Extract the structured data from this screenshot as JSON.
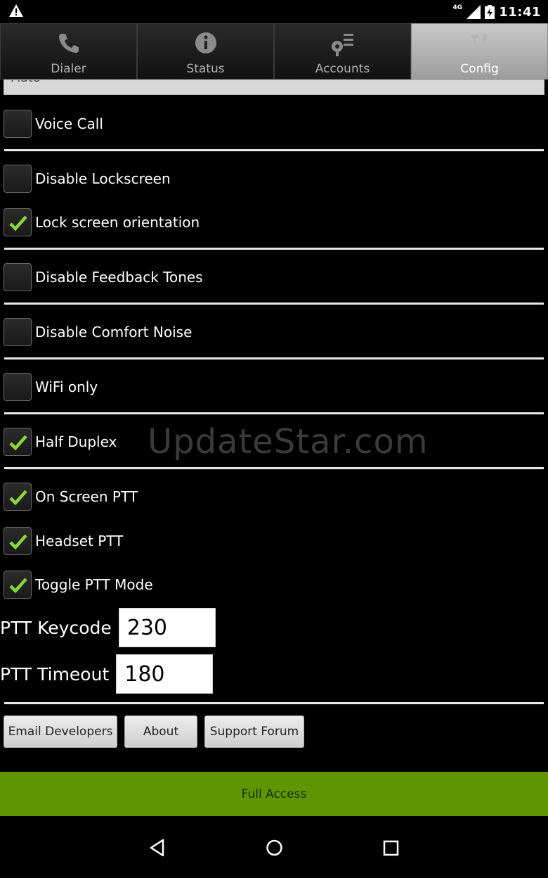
{
  "status_bar": {
    "warning_icon": "warning-icon",
    "network": "4G",
    "time": "11:41"
  },
  "tabs": [
    {
      "label": "Dialer",
      "icon": "phone-icon",
      "active": false
    },
    {
      "label": "Status",
      "icon": "info-icon",
      "active": false
    },
    {
      "label": "Accounts",
      "icon": "key-icon",
      "active": false
    },
    {
      "label": "Config",
      "icon": "tools-icon",
      "active": true
    }
  ],
  "top_select": {
    "value": "Auto"
  },
  "options": {
    "voice_call": {
      "label": "Voice Call",
      "checked": false
    },
    "disable_lockscreen": {
      "label": "Disable Lockscreen",
      "checked": false
    },
    "lock_orientation": {
      "label": "Lock screen orientation",
      "checked": true
    },
    "disable_feedback_tones": {
      "label": "Disable Feedback Tones",
      "checked": false
    },
    "disable_comfort_noise": {
      "label": "Disable Comfort Noise",
      "checked": false
    },
    "wifi_only": {
      "label": "WiFi only",
      "checked": false
    },
    "half_duplex": {
      "label": "Half Duplex",
      "checked": true
    },
    "on_screen_ptt": {
      "label": "On Screen PTT",
      "checked": true
    },
    "headset_ptt": {
      "label": "Headset PTT",
      "checked": true
    },
    "toggle_ptt_mode": {
      "label": "Toggle PTT Mode",
      "checked": true
    }
  },
  "ptt_keycode": {
    "label": "PTT Keycode",
    "value": "230"
  },
  "ptt_timeout": {
    "label": "PTT Timeout",
    "value": "180"
  },
  "buttons": {
    "email": "Email Developers",
    "about": "About",
    "support": "Support Forum"
  },
  "full_access": "Full Access",
  "watermark": "UpdateStar.com",
  "colors": {
    "accent_green": "#5f9600",
    "check_green": "#8bd63a"
  }
}
